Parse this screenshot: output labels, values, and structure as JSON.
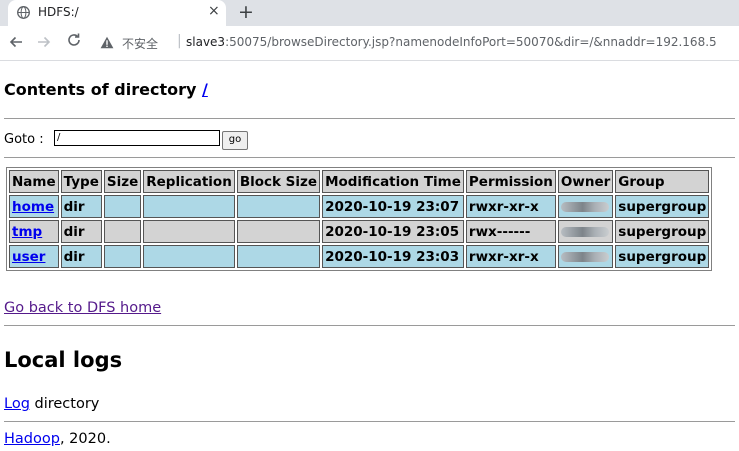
{
  "browser": {
    "tab_title": "HDFS:/",
    "tab_close": "×",
    "new_tab": "+",
    "security_label": "不安全",
    "url_host": "slave3",
    "url_rest": ":50075/browseDirectory.jsp?namenodeInfoPort=50070&dir=/&nnaddr=192.168.5"
  },
  "page": {
    "heading_prefix": "Contents of directory ",
    "heading_link": "/",
    "goto_label": "Goto :",
    "goto_value": "/",
    "go_button": "go",
    "columns": [
      "Name",
      "Type",
      "Size",
      "Replication",
      "Block Size",
      "Modification Time",
      "Permission",
      "Owner",
      "Group"
    ],
    "rows": [
      {
        "name": "home",
        "type": "dir",
        "size": "",
        "replication": "",
        "block_size": "",
        "modified": "2020-10-19 23:07",
        "permission": "rwxr-xr-x",
        "group": "supergroup"
      },
      {
        "name": "tmp",
        "type": "dir",
        "size": "",
        "replication": "",
        "block_size": "",
        "modified": "2020-10-19 23:05",
        "permission": "rwx------",
        "group": "supergroup"
      },
      {
        "name": "user",
        "type": "dir",
        "size": "",
        "replication": "",
        "block_size": "",
        "modified": "2020-10-19 23:03",
        "permission": "rwxr-xr-x",
        "group": "supergroup"
      }
    ],
    "back_link": "Go back to DFS home",
    "logs_heading": "Local logs",
    "log_link": "Log",
    "log_suffix": " directory",
    "footer_link": "Hadoop",
    "footer_suffix": ", 2020."
  },
  "icons": {
    "favicon": "globe-icon",
    "back": "arrow-left-icon",
    "forward": "arrow-right-icon",
    "reload": "reload-icon",
    "security": "warning-triangle-icon"
  },
  "colors": {
    "row_blue": "#add8e6",
    "row_gray": "#d3d3d3",
    "link": "#0000ee",
    "visited_link": "#551a8b"
  }
}
